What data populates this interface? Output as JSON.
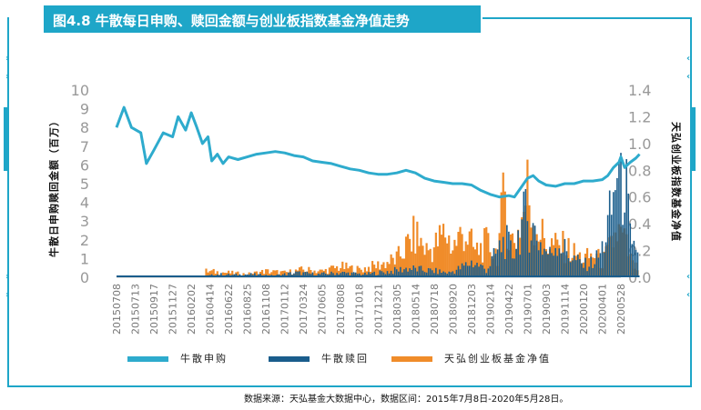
{
  "title": "图4.8 牛散每日申购、赎回金额与创业板指数基金净值走势",
  "source_note": "数据来源：天弘基金大数据中心，数据区间：2015年7月8日-2020年5月28日。",
  "colors": {
    "purchase": "#2eabcd",
    "redeem": "#1a5d8c",
    "nav": "#f08c2a",
    "frame": "#1ea6c8",
    "axis_text": "#999999"
  },
  "chart_data": {
    "type": "bar+line",
    "y_left_label": "牛散日申购赎回金额（百万）",
    "y_right_label": "天弘创业板指数基金净值",
    "y_left_range": [
      0,
      10
    ],
    "y_left_ticks": [
      "0",
      "1",
      "2",
      "3",
      "4",
      "5",
      "6",
      "7",
      "8",
      "9",
      "10"
    ],
    "y_right_range": [
      0.0,
      1.4
    ],
    "y_right_ticks": [
      "0.0",
      "0.2",
      "0.4",
      "0.6",
      "0.8",
      "1.0",
      "1.2",
      "1.4"
    ],
    "x_tick_labels": [
      "20150708",
      "20150713",
      "20150917",
      "20151127",
      "20160202",
      "20160414",
      "20160622",
      "20160825",
      "20161108",
      "20170112",
      "20170324",
      "20170605",
      "20170808",
      "20171018",
      "20171221",
      "20180305",
      "20180514",
      "20180718",
      "20180920",
      "20181203",
      "20190214",
      "20190422",
      "20190701",
      "20190903",
      "20191114",
      "20200120",
      "20200401",
      "20200528"
    ],
    "legend": [
      {
        "key": "purchase",
        "label": "牛散申购"
      },
      {
        "key": "redeem",
        "label": "牛散赎回"
      },
      {
        "key": "nav",
        "label": "天弘创业板基金净值"
      }
    ],
    "nav_series": {
      "name": "天弘创业板基金净值",
      "points": [
        [
          0,
          1.12
        ],
        [
          0.4,
          1.27
        ],
        [
          0.8,
          1.12
        ],
        [
          1.3,
          1.08
        ],
        [
          1.6,
          0.85
        ],
        [
          2.0,
          0.95
        ],
        [
          2.5,
          1.08
        ],
        [
          3.0,
          1.05
        ],
        [
          3.3,
          1.2
        ],
        [
          3.7,
          1.1
        ],
        [
          4.0,
          1.23
        ],
        [
          4.3,
          1.12
        ],
        [
          4.6,
          1.0
        ],
        [
          4.9,
          1.05
        ],
        [
          5.1,
          0.87
        ],
        [
          5.4,
          0.92
        ],
        [
          5.7,
          0.85
        ],
        [
          6.0,
          0.9
        ],
        [
          6.5,
          0.88
        ],
        [
          7.0,
          0.9
        ],
        [
          7.5,
          0.92
        ],
        [
          8.0,
          0.93
        ],
        [
          8.5,
          0.94
        ],
        [
          9.0,
          0.93
        ],
        [
          9.5,
          0.91
        ],
        [
          10.0,
          0.9
        ],
        [
          10.5,
          0.87
        ],
        [
          11.0,
          0.86
        ],
        [
          11.5,
          0.85
        ],
        [
          12.0,
          0.83
        ],
        [
          12.5,
          0.81
        ],
        [
          13.0,
          0.8
        ],
        [
          13.5,
          0.78
        ],
        [
          14.0,
          0.77
        ],
        [
          14.5,
          0.77
        ],
        [
          15.0,
          0.78
        ],
        [
          15.5,
          0.8
        ],
        [
          16.0,
          0.78
        ],
        [
          16.5,
          0.74
        ],
        [
          17.0,
          0.72
        ],
        [
          17.5,
          0.71
        ],
        [
          18.0,
          0.7
        ],
        [
          18.5,
          0.7
        ],
        [
          19.0,
          0.69
        ],
        [
          19.5,
          0.65
        ],
        [
          20.0,
          0.62
        ],
        [
          20.5,
          0.6
        ],
        [
          21.0,
          0.61
        ],
        [
          21.3,
          0.6
        ],
        [
          21.7,
          0.68
        ],
        [
          22.0,
          0.74
        ],
        [
          22.3,
          0.76
        ],
        [
          22.6,
          0.72
        ],
        [
          23.0,
          0.69
        ],
        [
          23.5,
          0.68
        ],
        [
          24.0,
          0.7
        ],
        [
          24.5,
          0.7
        ],
        [
          25.0,
          0.72
        ],
        [
          25.5,
          0.72
        ],
        [
          26.0,
          0.73
        ],
        [
          26.3,
          0.76
        ],
        [
          26.6,
          0.82
        ],
        [
          26.9,
          0.86
        ],
        [
          27.0,
          0.9
        ],
        [
          27.2,
          0.82
        ],
        [
          27.5,
          0.86
        ],
        [
          27.8,
          0.89
        ],
        [
          28.0,
          0.92
        ]
      ]
    },
    "redeem_series": {
      "name": "牛散赎回",
      "points": [
        [
          0,
          0.05
        ],
        [
          2.0,
          0.05
        ],
        [
          4.6,
          0.05
        ],
        [
          5.5,
          0.2
        ],
        [
          6.2,
          0.15
        ],
        [
          7.1,
          0.2
        ],
        [
          8.4,
          0.1
        ],
        [
          9.6,
          0.3
        ],
        [
          10.8,
          0.2
        ],
        [
          12.0,
          0.3
        ],
        [
          13.3,
          0.2
        ],
        [
          14.7,
          0.4
        ],
        [
          15.6,
          0.6
        ],
        [
          16.3,
          0.5
        ],
        [
          17.1,
          0.4
        ],
        [
          17.8,
          0.3
        ],
        [
          18.4,
          0.6
        ],
        [
          19.0,
          1.0
        ],
        [
          19.4,
          0.8
        ],
        [
          19.8,
          0.5
        ],
        [
          20.3,
          1.5
        ],
        [
          20.8,
          2.5
        ],
        [
          21.2,
          1.5
        ],
        [
          21.6,
          3.2
        ],
        [
          21.9,
          4.0
        ],
        [
          22.1,
          3.6
        ],
        [
          22.4,
          3.0
        ],
        [
          22.8,
          2.0
        ],
        [
          23.2,
          1.5
        ],
        [
          23.6,
          2.5
        ],
        [
          24.0,
          1.8
        ],
        [
          24.5,
          1.2
        ],
        [
          25.0,
          0.8
        ],
        [
          25.5,
          1.0
        ],
        [
          25.9,
          1.5
        ],
        [
          26.3,
          3.3
        ],
        [
          26.6,
          5.0
        ],
        [
          26.8,
          7.8
        ],
        [
          27.0,
          5.5
        ],
        [
          27.2,
          7.3
        ],
        [
          27.4,
          3.8
        ],
        [
          27.6,
          1.5
        ],
        [
          27.8,
          2.2
        ],
        [
          28.0,
          0.8
        ]
      ]
    },
    "purchase_series": {
      "name": "牛散申购",
      "points": [
        [
          4.8,
          0.4
        ],
        [
          6.0,
          0.3
        ],
        [
          7.0,
          0.2
        ],
        [
          8.0,
          0.4
        ],
        [
          9.0,
          0.3
        ],
        [
          10.0,
          0.5
        ],
        [
          11.0,
          0.4
        ],
        [
          12.0,
          0.7
        ],
        [
          13.0,
          0.5
        ],
        [
          14.0,
          0.8
        ],
        [
          15.0,
          1.2
        ],
        [
          16.0,
          2.8
        ],
        [
          16.6,
          1.8
        ],
        [
          17.0,
          2.0
        ],
        [
          17.6,
          3.0
        ],
        [
          18.0,
          2.0
        ],
        [
          18.6,
          3.1
        ],
        [
          19.2,
          1.7
        ],
        [
          19.8,
          2.2
        ],
        [
          20.4,
          1.6
        ],
        [
          20.8,
          5.8
        ],
        [
          21.0,
          2.5
        ],
        [
          21.4,
          2.6
        ],
        [
          21.8,
          4.4
        ],
        [
          22.0,
          5.8
        ],
        [
          22.3,
          4.0
        ],
        [
          22.6,
          3.2
        ],
        [
          23.0,
          2.3
        ],
        [
          23.6,
          2.0
        ],
        [
          24.0,
          2.0
        ],
        [
          24.6,
          1.5
        ],
        [
          25.0,
          1.2
        ],
        [
          25.6,
          1.5
        ],
        [
          26.0,
          1.0
        ],
        [
          26.4,
          1.8
        ],
        [
          26.8,
          3.0
        ],
        [
          27.2,
          2.4
        ],
        [
          27.6,
          0.8
        ],
        [
          28.0,
          0.5
        ]
      ]
    }
  }
}
